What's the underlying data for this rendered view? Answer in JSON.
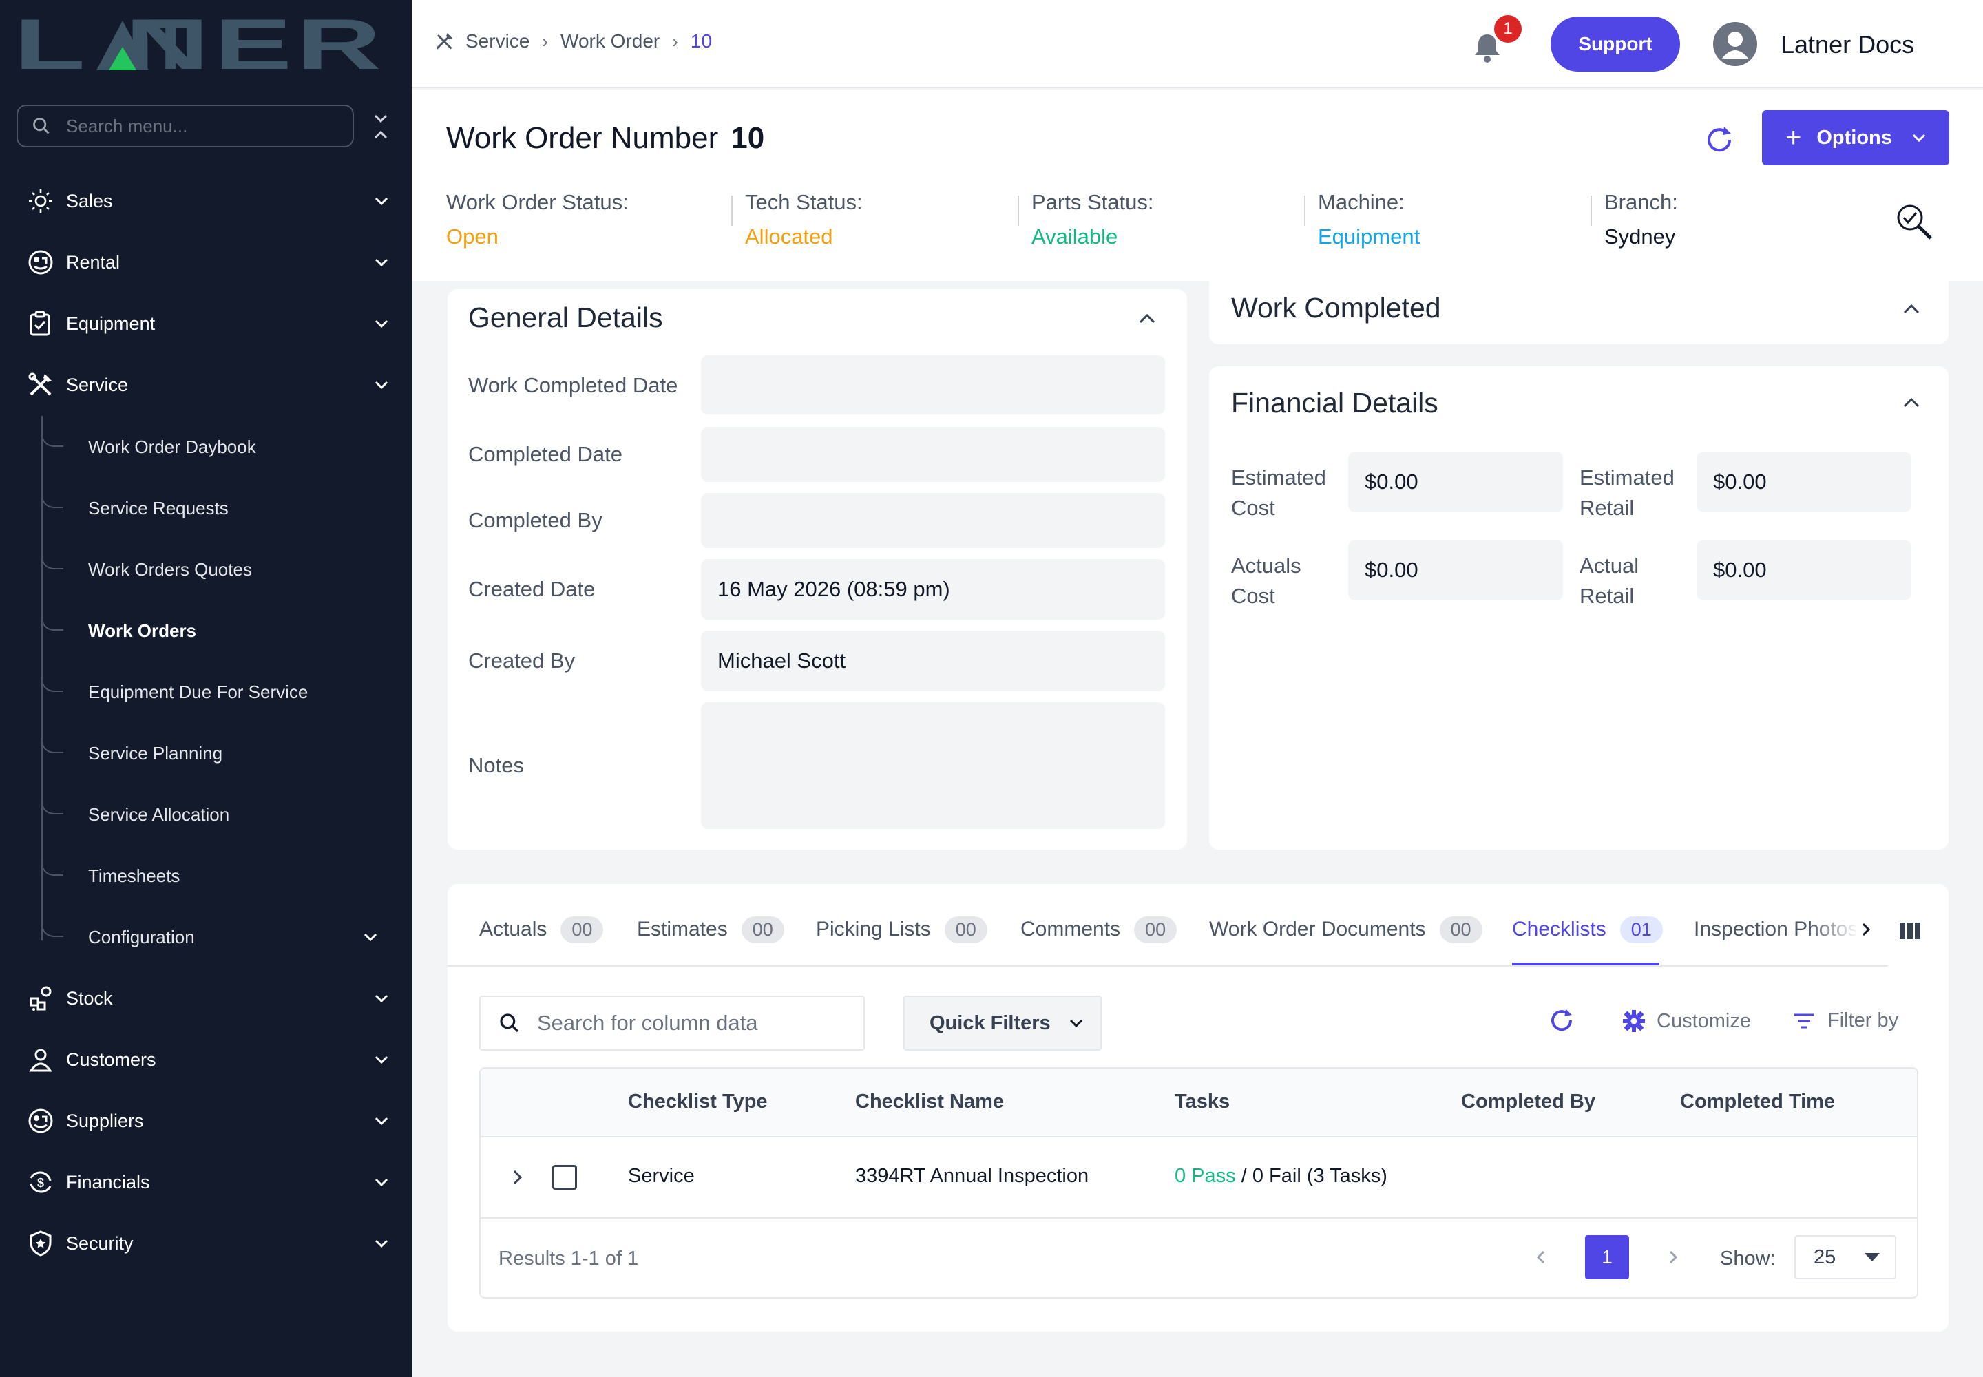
{
  "app": {
    "logo_text": "LATNER"
  },
  "sidebar": {
    "search_placeholder": "Search menu...",
    "items": [
      {
        "label": "Sales",
        "icon": "sales-icon"
      },
      {
        "label": "Rental",
        "icon": "rental-icon"
      },
      {
        "label": "Equipment",
        "icon": "equipment-icon"
      },
      {
        "label": "Service",
        "icon": "service-icon"
      },
      {
        "label": "Stock",
        "icon": "stock-icon"
      },
      {
        "label": "Customers",
        "icon": "customers-icon"
      },
      {
        "label": "Suppliers",
        "icon": "suppliers-icon"
      },
      {
        "label": "Financials",
        "icon": "financials-icon"
      },
      {
        "label": "Security",
        "icon": "security-icon"
      }
    ],
    "service_sub": [
      {
        "label": "Work Order Daybook"
      },
      {
        "label": "Service Requests"
      },
      {
        "label": "Work Orders Quotes"
      },
      {
        "label": "Work Orders"
      },
      {
        "label": "Equipment Due For Service"
      },
      {
        "label": "Service Planning"
      },
      {
        "label": "Service Allocation"
      },
      {
        "label": "Timesheets"
      },
      {
        "label": "Configuration"
      }
    ]
  },
  "topbar": {
    "breadcrumb": [
      "Service",
      "Work Order",
      "10"
    ],
    "notification_count": "1",
    "support_label": "Support",
    "user_name": "Latner Docs"
  },
  "header": {
    "title": "Work Order Number",
    "number": "10",
    "options_label": "Options",
    "statuses": [
      {
        "key": "Work Order Status:",
        "value": "Open",
        "color": "#f59e0b"
      },
      {
        "key": "Tech Status:",
        "value": "Allocated",
        "color": "#f59e0b"
      },
      {
        "key": "Parts Status:",
        "value": "Available",
        "color": "#10b981"
      },
      {
        "key": "Machine:",
        "value": "Equipment",
        "color": "#0ea5e9"
      },
      {
        "key": "Branch:",
        "value": "Sydney",
        "color": "#111827"
      }
    ]
  },
  "general": {
    "title": "General Details",
    "fields": [
      {
        "label": "Work Completed Date",
        "value": ""
      },
      {
        "label": "Completed Date",
        "value": ""
      },
      {
        "label": "Completed By",
        "value": ""
      },
      {
        "label": "Created Date",
        "value": "16 May 2026 (08:59 pm)"
      },
      {
        "label": "Created By",
        "value": "Michael Scott"
      },
      {
        "label": "Notes",
        "value": ""
      }
    ]
  },
  "work_completed": {
    "title": "Work Completed"
  },
  "financial": {
    "title": "Financial Details",
    "fields": [
      {
        "label1": "Estimated",
        "label2": "Cost",
        "value": "$0.00"
      },
      {
        "label1": "Estimated",
        "label2": "Retail",
        "value": "$0.00"
      },
      {
        "label1": "Actuals",
        "label2": "Cost",
        "value": "$0.00"
      },
      {
        "label1": "Actual",
        "label2": "Retail",
        "value": "$0.00"
      }
    ]
  },
  "tabs": [
    {
      "label": "Actuals",
      "count": "00"
    },
    {
      "label": "Estimates",
      "count": "00"
    },
    {
      "label": "Picking Lists",
      "count": "00"
    },
    {
      "label": "Comments",
      "count": "00"
    },
    {
      "label": "Work Order Documents",
      "count": "00"
    },
    {
      "label": "Checklists",
      "count": "01",
      "active": true
    },
    {
      "label": "Inspection Photos",
      "count": ""
    }
  ],
  "table": {
    "search_placeholder": "Search for column data",
    "quick_filters": "Quick Filters",
    "customize": "Customize",
    "filter_by": "Filter by",
    "columns": [
      "Checklist Type",
      "Checklist Name",
      "Tasks",
      "Completed By",
      "Completed Time"
    ],
    "rows": [
      {
        "type": "Service",
        "name": "3394RT Annual Inspection",
        "pass": "0 Pass",
        "rest": " / 0 Fail (3 Tasks)",
        "completed_by": "",
        "completed_time": ""
      }
    ],
    "results": "Results 1-1 of 1",
    "page": "1",
    "show_label": "Show:",
    "page_size": "25"
  }
}
